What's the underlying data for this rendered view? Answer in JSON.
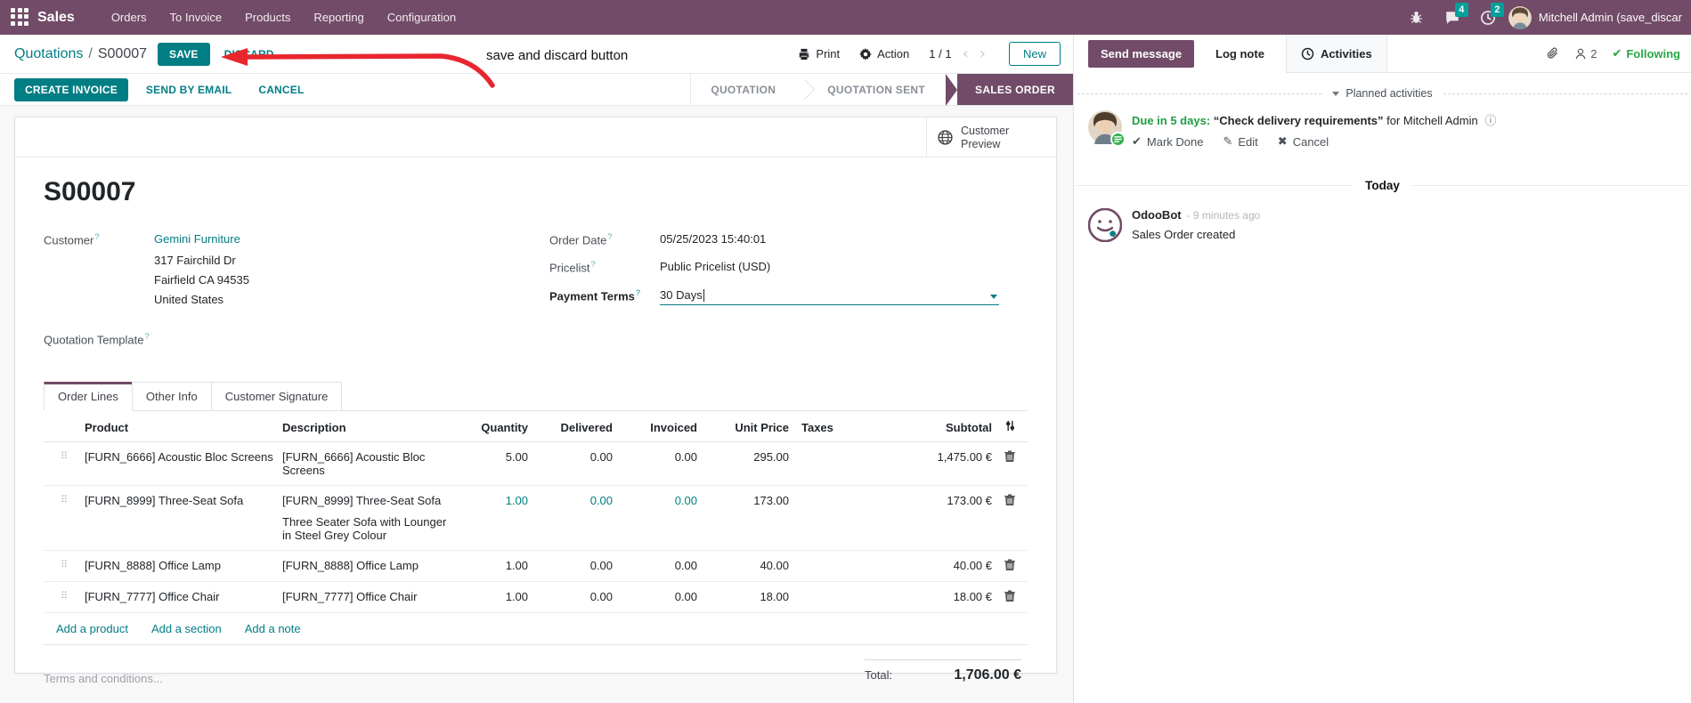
{
  "colors": {
    "brand": "#714B67",
    "accent": "#017E84",
    "badge": "#00A09D",
    "success": "#28a745",
    "annotation_red": "#E8262D"
  },
  "nav": {
    "app": "Sales",
    "items": [
      {
        "label": "Orders"
      },
      {
        "label": "To Invoice"
      },
      {
        "label": "Products"
      },
      {
        "label": "Reporting"
      },
      {
        "label": "Configuration"
      }
    ],
    "messages_badge": "4",
    "activities_badge": "2",
    "user": "Mitchell Admin (save_discar"
  },
  "control": {
    "breadcrumb_parent": "Quotations",
    "breadcrumb_sep": "/",
    "record": "S00007",
    "save": "SAVE",
    "discard": "DISCARD",
    "print": "Print",
    "action": "Action",
    "pager": "1 / 1",
    "new": "New"
  },
  "annotation": {
    "text": "save and discard button"
  },
  "statusbar": {
    "buttons": [
      {
        "label": "CREATE INVOICE"
      },
      {
        "label": "SEND BY EMAIL"
      },
      {
        "label": "CANCEL"
      }
    ],
    "stages": [
      {
        "label": "QUOTATION"
      },
      {
        "label": "QUOTATION SENT"
      },
      {
        "label": "SALES ORDER"
      }
    ],
    "active_stage": "SALES ORDER"
  },
  "form": {
    "preview_line1": "Customer",
    "preview_line2": "Preview",
    "title": "S00007",
    "customer_label": "Customer",
    "customer_name": "Gemini Furniture",
    "address": [
      "317 Fairchild Dr",
      "Fairfield CA 94535",
      "United States"
    ],
    "quotation_template_label": "Quotation Template",
    "order_date_label": "Order Date",
    "order_date_value": "05/25/2023 15:40:01",
    "pricelist_label": "Pricelist",
    "pricelist_value": "Public Pricelist (USD)",
    "payment_terms_label": "Payment Terms",
    "payment_terms_value": "30 Days",
    "tabs": [
      {
        "label": "Order Lines"
      },
      {
        "label": "Other Info"
      },
      {
        "label": "Customer Signature"
      }
    ],
    "table": {
      "headers": {
        "product": "Product",
        "description": "Description",
        "quantity": "Quantity",
        "delivered": "Delivered",
        "invoiced": "Invoiced",
        "unit_price": "Unit Price",
        "taxes": "Taxes",
        "subtotal": "Subtotal"
      },
      "rows": [
        {
          "product": "[FURN_6666] Acoustic Bloc Screens",
          "description": "[FURN_6666] Acoustic Bloc Screens",
          "description2": "",
          "quantity": "5.00",
          "delivered": "0.00",
          "invoiced": "0.00",
          "unit_price": "295.00",
          "taxes": "",
          "subtotal": "1,475.00 €"
        },
        {
          "product": "[FURN_8999] Three-Seat Sofa",
          "description": "[FURN_8999] Three-Seat Sofa",
          "description2": "Three Seater Sofa with Lounger in Steel Grey Colour",
          "quantity": "1.00",
          "delivered": "0.00",
          "invoiced": "0.00",
          "unit_price": "173.00",
          "taxes": "",
          "subtotal": "173.00 €"
        },
        {
          "product": "[FURN_8888] Office Lamp",
          "description": "[FURN_8888] Office Lamp",
          "description2": "",
          "quantity": "1.00",
          "delivered": "0.00",
          "invoiced": "0.00",
          "unit_price": "40.00",
          "taxes": "",
          "subtotal": "40.00 €"
        },
        {
          "product": "[FURN_7777] Office Chair",
          "description": "[FURN_7777] Office Chair",
          "description2": "",
          "quantity": "1.00",
          "delivered": "0.00",
          "invoiced": "0.00",
          "unit_price": "18.00",
          "taxes": "",
          "subtotal": "18.00 €"
        }
      ],
      "links": [
        {
          "label": "Add a product"
        },
        {
          "label": "Add a section"
        },
        {
          "label": "Add a note"
        }
      ]
    },
    "terms_placeholder": "Terms and conditions...",
    "total_label": "Total:",
    "total_value": "1,706.00 €"
  },
  "chatter": {
    "send_message": "Send message",
    "log_note": "Log note",
    "activities": "Activities",
    "followers_count": "2",
    "following": "Following",
    "planned_header": "Planned activities",
    "activity": {
      "due": "Due in 5 days:",
      "title": "“Check delivery requirements”",
      "for_text": "for Mitchell Admin",
      "mark_done": "Mark Done",
      "edit": "Edit",
      "cancel": "Cancel"
    },
    "today": "Today",
    "message": {
      "author": "OdooBot",
      "time": "- 9 minutes ago",
      "body": "Sales Order created"
    }
  }
}
